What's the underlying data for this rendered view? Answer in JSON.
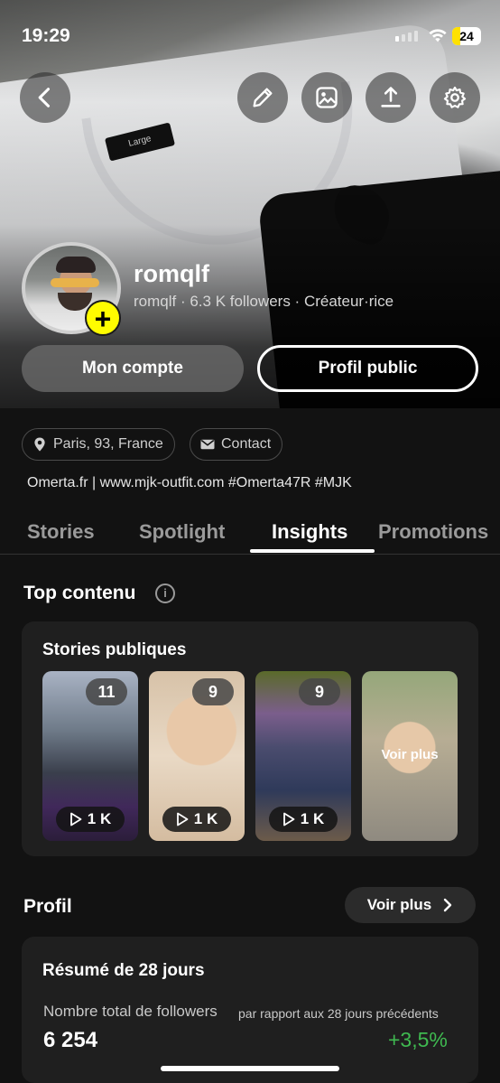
{
  "status_bar": {
    "time": "19:29",
    "battery": "24"
  },
  "top_actions": {
    "back": "back-icon",
    "edit": "pencil-icon",
    "image": "image-icon",
    "share": "share-icon",
    "settings": "gear-icon"
  },
  "profile": {
    "name": "romqlf",
    "subtitle": "romqlf · 6.3 K followers · Créateur·rice",
    "add_badge": "+",
    "buttons": {
      "account": "Mon compte",
      "public_profile": "Profil public"
    }
  },
  "info": {
    "location": "Paris, 93, France",
    "contact": "Contact",
    "bio": "Omerta.fr | www.mjk-outfit.com #Omerta47R #MJK"
  },
  "tabs": [
    {
      "label": "Stories",
      "active": false
    },
    {
      "label": "Spotlight",
      "active": false
    },
    {
      "label": "Insights",
      "active": true
    },
    {
      "label": "Promotions",
      "active": false
    }
  ],
  "top_content": {
    "title": "Top contenu",
    "card_title": "Stories publiques",
    "stories": [
      {
        "count": "11",
        "views": "1 K"
      },
      {
        "count": "9",
        "views": "1 K"
      },
      {
        "count": "9",
        "views": "1 K"
      }
    ],
    "see_more_tile": "Voir plus"
  },
  "profile_section": {
    "title": "Profil",
    "see_more": "Voir plus",
    "summary_title": "Résumé de 28 jours",
    "metric_label": "Nombre total de followers",
    "metric_compare": "par rapport aux 28 jours précédents",
    "metric_value": "6 254",
    "metric_change": "+3,5%"
  },
  "colors": {
    "accent_yellow": "#fffc00",
    "positive_green": "#3fb950",
    "background": "#121212",
    "card": "#1f1f1f"
  }
}
